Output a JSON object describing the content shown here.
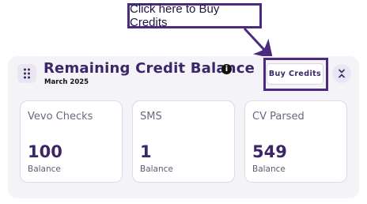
{
  "callout": {
    "text": "Click here to Buy Credits"
  },
  "widget": {
    "title": "Remaining Credit Balance",
    "subtitle": "March 2025",
    "buy_label": "Buy Credits",
    "info_glyph": "i",
    "icons": {
      "drag": "drag-handle-icon",
      "info": "info-icon",
      "collapse": "collapse-chevrons-icon"
    }
  },
  "stats": [
    {
      "label": "Vevo Checks",
      "value": "100",
      "caption": "Balance"
    },
    {
      "label": "SMS",
      "value": "1",
      "caption": "Balance"
    },
    {
      "label": "CV Parsed",
      "value": "549",
      "caption": "Balance"
    }
  ],
  "colors": {
    "accent": "#3b2669",
    "annotation": "#4b2a7f",
    "card_bg": "#f4f3f7"
  }
}
